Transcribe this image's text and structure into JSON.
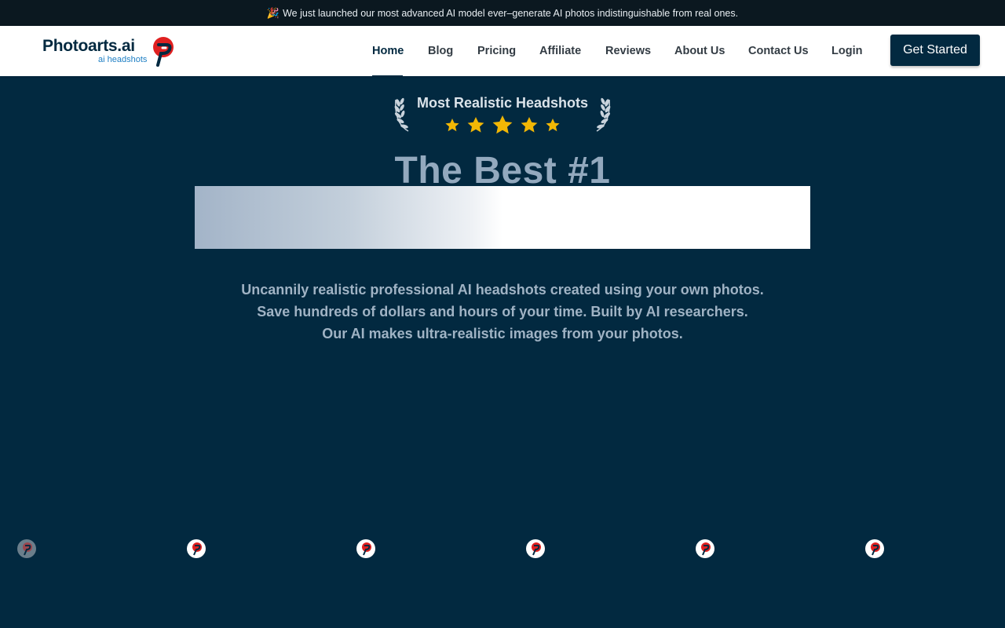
{
  "announcement": {
    "emoji": "🎉",
    "text": "We just launched our most advanced AI model ever–generate AI photos indistinguishable from real ones."
  },
  "brand": {
    "name": "Photoarts.ai",
    "tagline": "ai headshots",
    "mark_color": "#e02020"
  },
  "nav": {
    "items": [
      {
        "label": "Home",
        "active": true
      },
      {
        "label": "Blog"
      },
      {
        "label": "Pricing"
      },
      {
        "label": "Affiliate"
      },
      {
        "label": "Reviews"
      },
      {
        "label": "About Us"
      },
      {
        "label": "Contact Us"
      },
      {
        "label": "Login"
      }
    ],
    "cta": "Get Started"
  },
  "hero": {
    "award_title": "Most Realistic Headshots",
    "rating_stars": 5,
    "headline": "The Best #1",
    "description": [
      "Uncannily realistic professional AI headshots created using your own photos.",
      "Save hundreds of dollars and hours of your time. Built by AI researchers.",
      "Our AI makes ultra-realistic images from your photos."
    ]
  },
  "colors": {
    "primary": "#022940",
    "star": "#f2b705",
    "accent": "#e02020"
  }
}
